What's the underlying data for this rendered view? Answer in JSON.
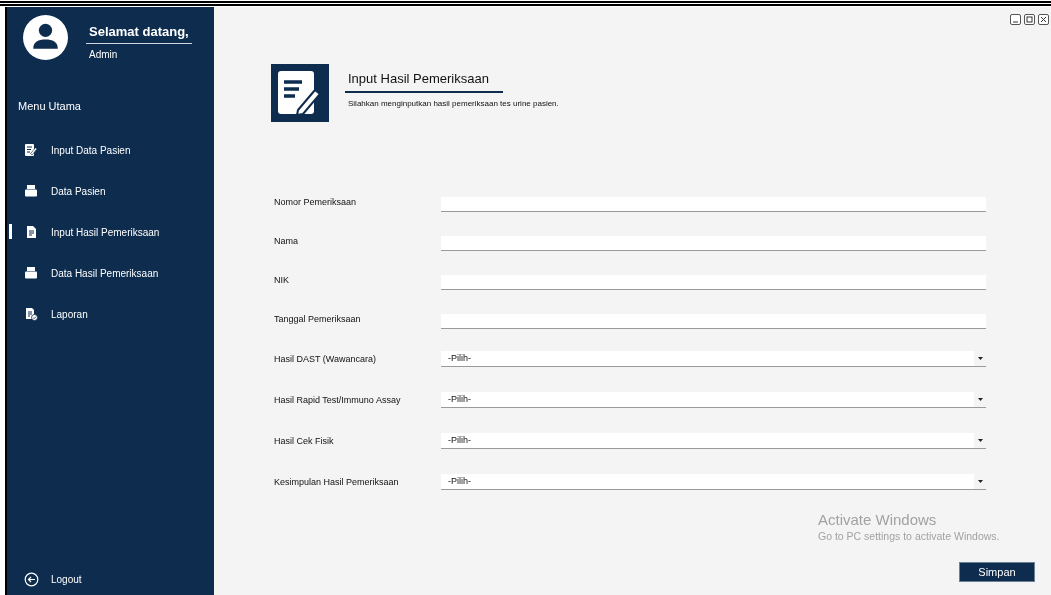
{
  "sidebar": {
    "greeting": "Selamat datang,",
    "user": "Admin",
    "menu_title": "Menu Utama",
    "items": [
      {
        "label": "Input Data Pasien",
        "selected": false
      },
      {
        "label": "Data Pasien",
        "selected": false
      },
      {
        "label": "Input Hasil Pemeriksaan",
        "selected": true
      },
      {
        "label": "Data Hasil Pemeriksaan",
        "selected": false
      },
      {
        "label": "Laporan",
        "selected": false
      }
    ],
    "logout": "Logout"
  },
  "header": {
    "title": "Input Hasil Pemeriksaan",
    "subtitle": "Silahkan menginputkan hasil pemeriksaan tes urine pasien."
  },
  "form": {
    "fields": [
      {
        "label": "Nomor Pemeriksaan",
        "kind": "text"
      },
      {
        "label": "Nama",
        "kind": "text"
      },
      {
        "label": "NIK",
        "kind": "text"
      },
      {
        "label": "Tanggal Pemeriksaan",
        "kind": "text"
      },
      {
        "label": "Hasil DAST (Wawancara)",
        "kind": "select",
        "value": "-Pilih-"
      },
      {
        "label": "Hasil Rapid Test/Immuno Assay",
        "kind": "select",
        "value": "-Pilih-"
      },
      {
        "label": "Hasil Cek Fisik",
        "kind": "select",
        "value": "-Pilih-"
      },
      {
        "label": "Kesimpulan Hasil Pemeriksaan",
        "kind": "select",
        "value": "-Pilih-"
      }
    ]
  },
  "activation": {
    "title": "Activate Windows",
    "message": "Go to PC settings to activate Windows."
  },
  "save_button": "Simpan"
}
